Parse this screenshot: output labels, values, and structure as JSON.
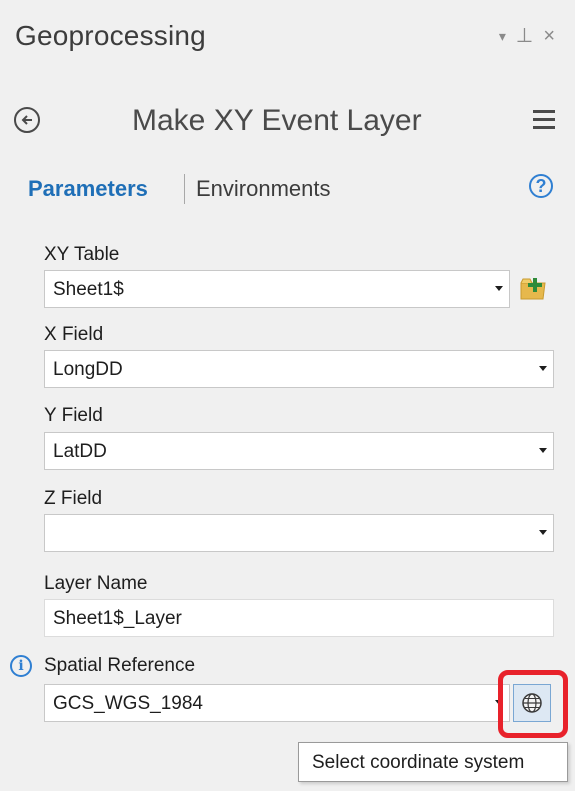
{
  "pane": {
    "title": "Geoprocessing",
    "controls": {
      "dropdown": "▾",
      "pin": "⊥",
      "close": "×"
    }
  },
  "tool": {
    "title": "Make XY Event Layer"
  },
  "tabs": [
    {
      "label": "Parameters",
      "active": true
    },
    {
      "label": "Environments",
      "active": false
    }
  ],
  "help_label": "?",
  "fields": {
    "xy_table": {
      "label": "XY Table",
      "value": "Sheet1$"
    },
    "x_field": {
      "label": "X Field",
      "value": "LongDD"
    },
    "y_field": {
      "label": "Y Field",
      "value": "LatDD"
    },
    "z_field": {
      "label": "Z Field",
      "value": ""
    },
    "layer_name": {
      "label": "Layer Name",
      "value": "Sheet1$_Layer"
    },
    "spatial_reference": {
      "label": "Spatial Reference",
      "value": "GCS_WGS_1984"
    }
  },
  "info_glyph": "i",
  "tooltip": "Select coordinate system",
  "colors": {
    "accent": "#1f6fb7",
    "highlight": "#e8222b",
    "background": "#f0f0f0"
  }
}
